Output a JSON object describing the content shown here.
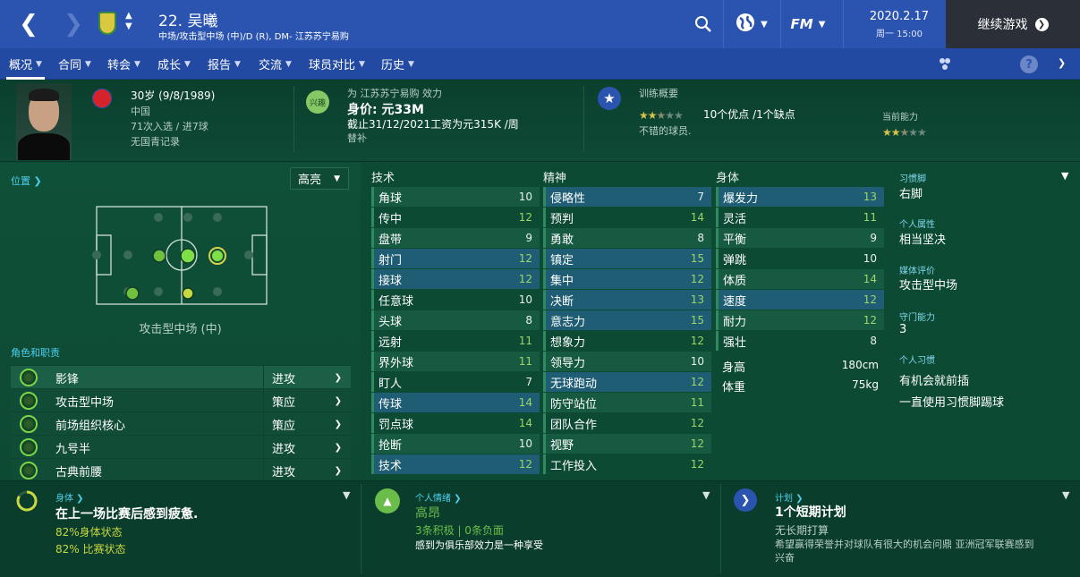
{
  "header": {
    "player_title": "22. 吴曦",
    "positions": "中场/攻击型中场 (中)/D (R), DM- 江苏苏宁易购",
    "date": "2020.2.17",
    "weekday_time": "周一 15:00",
    "continue_label": "继续游戏",
    "fm_label": "FM"
  },
  "tabs": [
    {
      "label": "概况",
      "active": true
    },
    {
      "label": "合同"
    },
    {
      "label": "转会"
    },
    {
      "label": "成长"
    },
    {
      "label": "报告"
    },
    {
      "label": "交流"
    },
    {
      "label": "球员对比"
    },
    {
      "label": "历史"
    }
  ],
  "profile": {
    "age": "30岁 (9/8/1989)",
    "nation": "中国",
    "caps": "71次入选 / 进7球",
    "youth": "无国青记录",
    "club_line": "为 江苏苏宁易购 效力",
    "interest_badge": "兴趣",
    "value": "身价: 元33M",
    "contract": "截止31/12/2021工资为元315K /周",
    "squad_status": "替补",
    "training_label": "训练概要",
    "training_summary": "10个优点 /1个缺点",
    "training_desc": "不错的球员.",
    "current_ability_label": "当前能力",
    "training_stars": 2.5,
    "ability_stars": 2.5
  },
  "pitch": {
    "position_link": "位置",
    "highlight_select": "高亮",
    "position_name": "攻击型中场 (中)",
    "roles_label": "角色和职责"
  },
  "roles": [
    {
      "name": "影锋",
      "duty": "进攻"
    },
    {
      "name": "攻击型中场",
      "duty": "策应"
    },
    {
      "name": "前场组织核心",
      "duty": "策应"
    },
    {
      "name": "九号半",
      "duty": "进攻"
    },
    {
      "name": "古典前腰",
      "duty": "进攻"
    }
  ],
  "attributes": {
    "technical_label": "技术",
    "mental_label": "精神",
    "physical_label": "身体",
    "technical": [
      {
        "name": "角球",
        "value": "10"
      },
      {
        "name": "传中",
        "value": "12"
      },
      {
        "name": "盘带",
        "value": "9"
      },
      {
        "name": "射门",
        "value": "12"
      },
      {
        "name": "接球",
        "value": "12"
      },
      {
        "name": "任意球",
        "value": "10"
      },
      {
        "name": "头球",
        "value": "8"
      },
      {
        "name": "远射",
        "value": "11"
      },
      {
        "name": "界外球",
        "value": "11"
      },
      {
        "name": "盯人",
        "value": "7"
      },
      {
        "name": "传球",
        "value": "14"
      },
      {
        "name": "罚点球",
        "value": "14"
      },
      {
        "name": "抢断",
        "value": "10"
      },
      {
        "name": "技术",
        "value": "12"
      }
    ],
    "mental": [
      {
        "name": "侵略性",
        "value": "7"
      },
      {
        "name": "预判",
        "value": "14"
      },
      {
        "name": "勇敢",
        "value": "8"
      },
      {
        "name": "镇定",
        "value": "15"
      },
      {
        "name": "集中",
        "value": "12"
      },
      {
        "name": "决断",
        "value": "13"
      },
      {
        "name": "意志力",
        "value": "15"
      },
      {
        "name": "想象力",
        "value": "12"
      },
      {
        "name": "领导力",
        "value": "10"
      },
      {
        "name": "无球跑动",
        "value": "12"
      },
      {
        "name": "防守站位",
        "value": "11"
      },
      {
        "name": "团队合作",
        "value": "12"
      },
      {
        "name": "视野",
        "value": "12"
      },
      {
        "name": "工作投入",
        "value": "12"
      }
    ],
    "physical": [
      {
        "name": "爆发力",
        "value": "13"
      },
      {
        "name": "灵活",
        "value": "11"
      },
      {
        "name": "平衡",
        "value": "9"
      },
      {
        "name": "弹跳",
        "value": "10"
      },
      {
        "name": "体质",
        "value": "14"
      },
      {
        "name": "速度",
        "value": "12"
      },
      {
        "name": "耐力",
        "value": "12"
      },
      {
        "name": "强壮",
        "value": "8"
      }
    ],
    "height_label": "身高",
    "height": "180cm",
    "weight_label": "体重",
    "weight": "75kg"
  },
  "info": {
    "foot_label": "习惯脚",
    "foot": "右脚",
    "personality_label": "个人属性",
    "personality": "相当坚决",
    "media_label": "媒体评价",
    "media": "攻击型中场",
    "gk_label": "守门能力",
    "gk": "3",
    "habits_label": "个人习惯",
    "habit1": "有机会就前插",
    "habit2": "一直使用习惯脚踢球"
  },
  "bottom": {
    "fitness_label": "身体",
    "fitness_title": "在上一场比赛后感到疲惫.",
    "fitness_pct": "82%身体状态",
    "match_pct": "82% 比赛状态",
    "morale_label": "个人情绪",
    "morale_value": "高昂",
    "morale_counts": "3条积极 | 0条负面",
    "morale_desc": "感到为俱乐部效力是一种享受",
    "plan_label": "计划",
    "plan_title": "1个短期计划",
    "plan_sub": "无长期打算",
    "plan_desc": "希望赢得荣誉并对球队有很大的机会问鼎 亚洲冠军联赛感到兴奋"
  }
}
